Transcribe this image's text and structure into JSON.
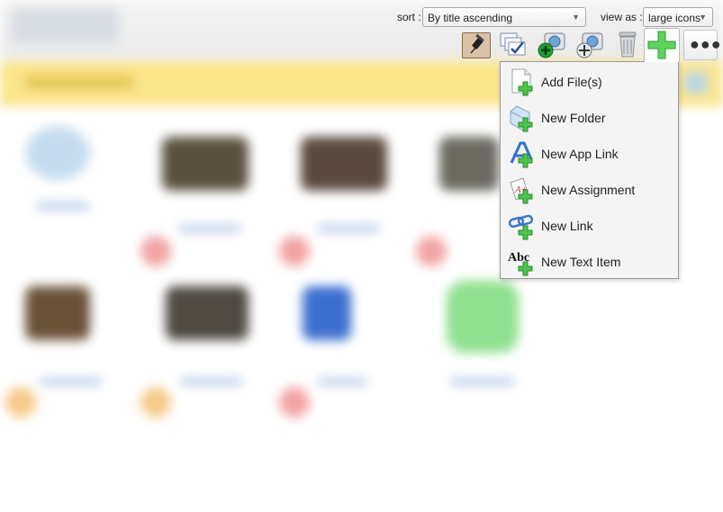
{
  "toolbar": {
    "sort_label": "sort :",
    "sort_value": "By title ascending",
    "view_label": "view as :",
    "view_value": "large icons"
  },
  "icons": {
    "pin": "thumbtack-icon",
    "select": "multi-select-check-icon",
    "share": "globe-add-icon",
    "move": "globe-move-icon",
    "delete": "trash-icon",
    "add": "plus-icon",
    "more": "ellipsis-icon"
  },
  "add_menu": {
    "items": [
      {
        "label": "Add File(s)",
        "icon": "file-add-icon"
      },
      {
        "label": "New Folder",
        "icon": "folder-add-icon"
      },
      {
        "label": "New App Link",
        "icon": "app-link-add-icon"
      },
      {
        "label": "New Assignment",
        "icon": "assignment-add-icon"
      },
      {
        "label": "New Link",
        "icon": "link-add-icon"
      },
      {
        "label": "New Text Item",
        "icon": "text-add-icon",
        "glyph": "Abc"
      }
    ]
  },
  "colors": {
    "banner": "#fbe58a",
    "accent_green": "#3db53d",
    "pin_button_bg": "#d9c2a8"
  }
}
